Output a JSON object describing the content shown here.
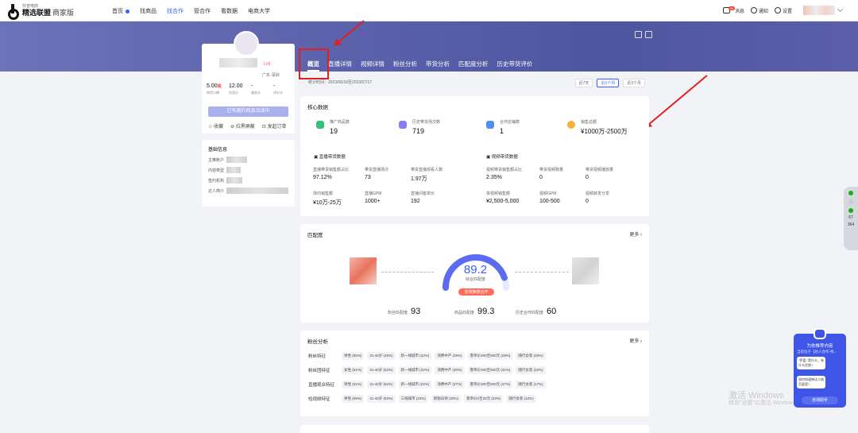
{
  "topbar": {
    "logo_sub": "抖音电商",
    "logo_main": "精选联盟",
    "logo_edition": "商家版",
    "nav": [
      "首页",
      "找商品",
      "找合作",
      "管合作",
      "看数据",
      "电商大学"
    ],
    "active_nav": "找合作",
    "messages_label": "消息",
    "messages_badge": "99",
    "notify_label": "通知",
    "settings_label": "设置"
  },
  "profile": {
    "level": "LV6",
    "location": "广东·深圳",
    "stats": [
      {
        "value": "5.00",
        "grade": "高",
        "label": "带货口碑"
      },
      {
        "value": "12.00",
        "grade": "",
        "label": "信用分"
      },
      {
        "value": "-",
        "grade": "",
        "label": "服务分"
      },
      {
        "value": "-",
        "grade": "",
        "label": "评价分"
      }
    ],
    "invite_button": "已有邀约商品洽谈中",
    "actions": [
      "收藏",
      "拉黑屏蔽",
      "发起订单"
    ]
  },
  "basic_info": {
    "title": "基础信息",
    "fields": [
      "主推账户",
      "内容类型",
      "签约机构",
      "达人简介"
    ]
  },
  "tabs": [
    "概览",
    "直播详情",
    "视频详情",
    "粉丝分析",
    "带货分析",
    "匹配度分析",
    "历史带货评价"
  ],
  "active_tab": "概览",
  "date": {
    "range_label": "统计时间：2023/06/18至2023/07/17",
    "buttons": [
      "近7天",
      "近1个月",
      "近3个月"
    ],
    "active": "近1个月"
  },
  "core": {
    "title": "核心数据",
    "kpis": [
      {
        "label": "推广商品数",
        "value": "19",
        "color": "#35c37a"
      },
      {
        "label": "历史带货场次数",
        "value": "719",
        "color": "#8a7cf4"
      },
      {
        "label": "合作店铺数",
        "value": "1",
        "color": "#4f8df7"
      },
      {
        "label": "销售总额",
        "value": "¥1000万-2500万",
        "color": "#f4b23b"
      }
    ],
    "live_title": "直播带货数据",
    "video_title": "视频带货数据",
    "live_cells": [
      {
        "label": "直播带货销售额占比",
        "value": "97.12%"
      },
      {
        "label": "带货直播场次",
        "value": "73"
      },
      {
        "label": "带货直播观看人数",
        "value": "1.97万"
      },
      {
        "label": "场均销售额",
        "value": "¥10万-25万"
      },
      {
        "label": "直播GPM",
        "value": "1000+"
      },
      {
        "label": "直播间客单价",
        "value": "192"
      }
    ],
    "video_cells": [
      {
        "label": "视频带货销售额占比",
        "value": "2.35%"
      },
      {
        "label": "带货视频数量",
        "value": "0"
      },
      {
        "label": "带货视频播放量",
        "value": "0"
      },
      {
        "label": "单视频销售额",
        "value": "¥2,500-5,000"
      },
      {
        "label": "视频GPM",
        "value": "100-500"
      },
      {
        "label": "视频转发分享",
        "value": "0"
      }
    ]
  },
  "match": {
    "title": "匹配度",
    "more": "更多",
    "score": "89.2",
    "score_label": "综合匹配度",
    "tag": "非常推荐合作",
    "score_fraction": 0.892,
    "subs": [
      {
        "label": "粉丝匹配度",
        "value": "93"
      },
      {
        "label": "商品匹配度",
        "value": "99.3"
      },
      {
        "label": "历史合作匹配度",
        "value": "60"
      }
    ]
  },
  "fans": {
    "title": "粉丝分析",
    "more": "更多",
    "rows": [
      {
        "key": "粉丝特征",
        "chips": [
          "男性 (55%)",
          "31-40岁 (48%)",
          "新一线城市 (22%)",
          "消费中产 (29%)",
          "客单价300至500元 (28%)",
          "随行女装 (20%)"
        ]
      },
      {
        "key": "粉丝团特征",
        "chips": [
          "女性 (51%)",
          "31-40岁 (52%)",
          "新一线城市 (22%)",
          "消费中产 (30%)",
          "客单价300至500元 (31%)",
          "随行女装 (22%)"
        ]
      },
      {
        "key": "直播观众特征",
        "chips": [
          "男性 (51%)",
          "31-40岁 (52%)",
          "新一线城市 (22%)",
          "消费中产 (27%)",
          "客单价300至500元 (27%)",
          "随行女装 (17%)"
        ]
      },
      {
        "key": "短视频特征",
        "chips": [
          "男性 (69%)",
          "31-40岁 (53%)",
          "三线城市 (23%)",
          "新锐白领 (20%)",
          "客单价0至25元 (23%)",
          "随行女装 (12%)"
        ]
      }
    ]
  },
  "watermark": {
    "line1": "激活 Windows",
    "line2": "转到\"设置\"以激活 Windows。"
  },
  "sidebar": {
    "n1": "67",
    "n2": "364"
  },
  "helper": {
    "title": "为你推荐内容",
    "subtitle": "当前位于【达人合作-找...",
    "q1": "\"罗盘 \"是什么，有什么优势?",
    "q2": "如何知道带达人结页面里?",
    "button": "咨询助手"
  }
}
